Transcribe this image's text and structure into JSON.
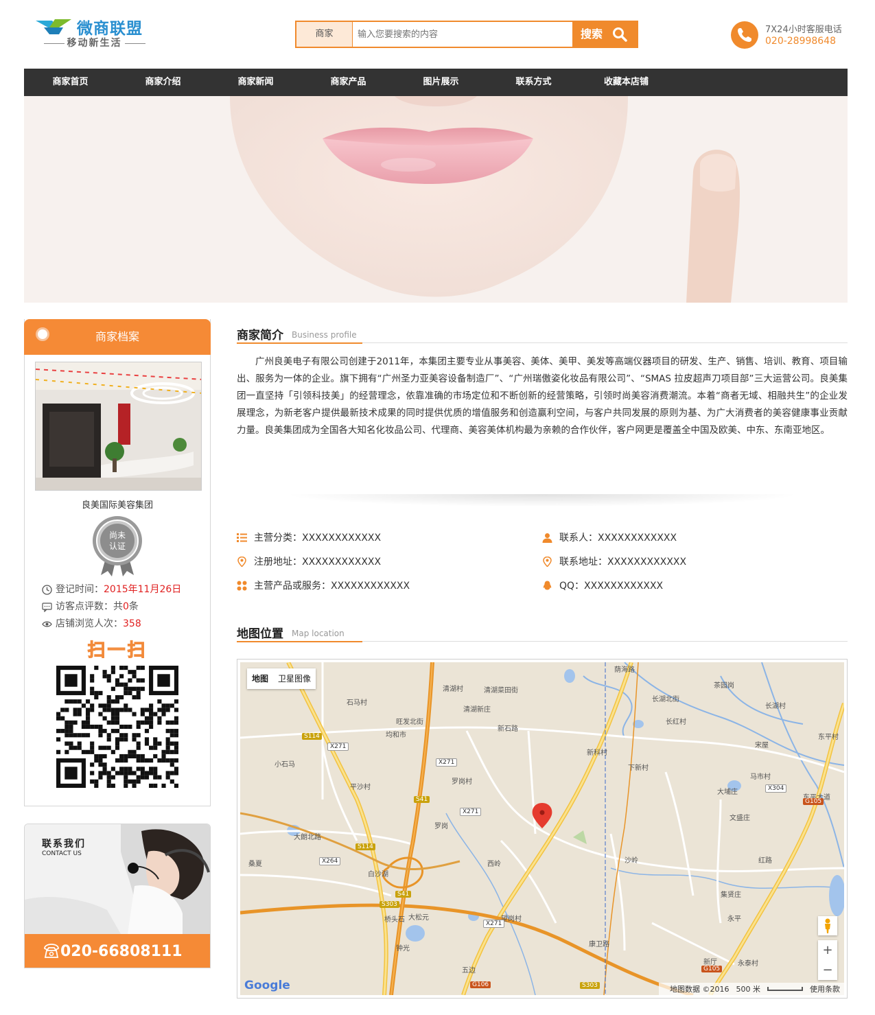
{
  "header": {
    "logo_title": "微商联盟",
    "logo_tagline": "移动新生活",
    "search_category": "商家",
    "search_placeholder": "输入您要搜索的内容",
    "search_button": "搜索",
    "service_label": "7X24小时客服电话",
    "service_phone": "020-28998648"
  },
  "nav": {
    "items": [
      "商家首页",
      "商家介绍",
      "商家新闻",
      "商家产品",
      "图片展示",
      "联系方式",
      "收藏本店铺"
    ]
  },
  "profile": {
    "header": "商家档案",
    "company_name": "良美国际美容集团",
    "badge_text": "尚未认证",
    "register_label": "登记时间：",
    "register_value": "2015年11月26日",
    "reviews_label": "访客点评数：共",
    "reviews_value": "0",
    "reviews_suffix": "条",
    "views_label": "店铺浏览人次：",
    "views_value": "358",
    "scan_text": "扫一扫"
  },
  "contact": {
    "title": "联系我们",
    "subtitle": "CONTACT US",
    "phone": "020-66808111"
  },
  "intro": {
    "title": "商家简介",
    "title_en": "Business profile",
    "text": "广州良美电子有限公司创建于2011年，本集团主要专业从事美容、美体、美甲、美发等高端仪器项目的研发、生产、销售、培训、教育、项目输出、服务为一体的企业。旗下拥有“广州圣力亚美容设备制造厂”、“广州瑞傲姿化妆品有限公司”、“SMAS 拉皮超声刀项目部”三大运营公司。良美集团一直坚持「引领科技美」的经营理念，依靠准确的市场定位和不断创新的经营策略，引领时尚美容消费潮流。本着“商者无域、相融共生”的企业发展理念，为新老客户提供最新技术成果的同时提供优质的增值服务和创造赢利空间，与客户共同发展的原则为基、为广大消费者的美容健康事业贡献力量。良美集团成为全国各大知名化妆品公司、代理商、美容美体机构最为亲赖的合作伙伴，客户网更是覆盖全中国及欧美、中东、东南亚地区。"
  },
  "facts": {
    "category": "主营分类：XXXXXXXXXXXX",
    "contact_person": "联系人：XXXXXXXXXXXX",
    "reg_address": "注册地址：XXXXXXXXXXXX",
    "contact_address": "联系地址：XXXXXXXXXXXX",
    "products": "主营产品或服务：XXXXXXXXXXXX",
    "qq": "QQ：XXXXXXXXXXXX"
  },
  "map": {
    "title": "地图位置",
    "title_en": "Map location",
    "tab_map": "地图",
    "tab_satellite": "卫星图像",
    "zoom_in": "+",
    "zoom_out": "−",
    "attribution": "地图数据 ©2016",
    "scale": "500 米",
    "terms": "使用条款",
    "google": "Google",
    "labels": [
      "荫海路",
      "茶园岗",
      "清湖村",
      "清湖菜田街",
      "长湖北街",
      "石马村",
      "长湖村",
      "旺发北街",
      "清湖新庄",
      "长红村",
      "新石路",
      "均和市",
      "新科村",
      "宋屋",
      "东平村",
      "小石马",
      "罗岗村",
      "下新村",
      "马市村",
      "平沙村",
      "大埔庄",
      "东平大道",
      "罗岗",
      "文盛庄",
      "大朗北路",
      "红路",
      "桑夏",
      "西岭",
      "沙岭",
      "白沙湖",
      "集贤庄",
      "桥头石",
      "大松元",
      "望岗村",
      "永平",
      "钟光",
      "新厅",
      "永泰村",
      "五边",
      "康卫路"
    ],
    "shields": [
      "S114",
      "X271",
      "X271",
      "S41",
      "X271",
      "X264",
      "S114",
      "S41",
      "S303",
      "X271",
      "X304",
      "G105",
      "G106",
      "S303",
      "G105"
    ]
  },
  "colors": {
    "accent": "#f08a2c",
    "nav_bg": "#333333",
    "highlight_red": "#e02020"
  }
}
